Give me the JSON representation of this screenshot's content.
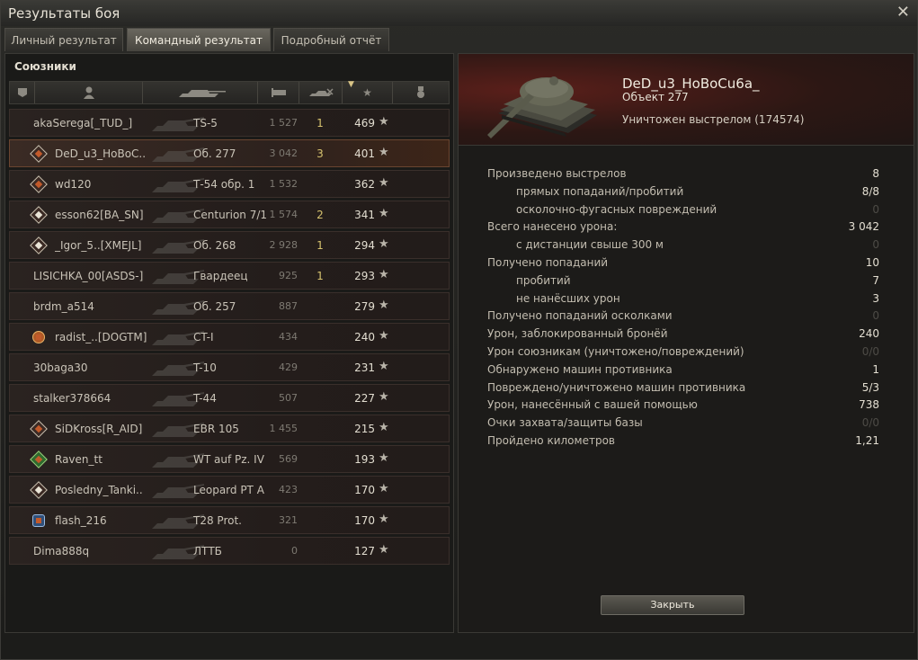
{
  "window": {
    "title": "Результаты боя"
  },
  "tabs": [
    {
      "label": "Личный результат"
    },
    {
      "label": "Командный результат"
    },
    {
      "label": "Подробный отчёт"
    }
  ],
  "allies_label": "Союзники",
  "players": [
    {
      "name": "akaSerega[_TUD_]",
      "tank": "TS-5",
      "damage": "1 527",
      "kills": "1",
      "xp": "469",
      "rank": ""
    },
    {
      "name": "DeD_u3_HoBoC..",
      "tank": "Об. 277",
      "damage": "3 042",
      "kills": "3",
      "xp": "401",
      "rank": "orange-diamond"
    },
    {
      "name": "wd120",
      "tank": "Т-54 обр. 1",
      "damage": "1 532",
      "kills": "",
      "xp": "362",
      "rank": "orange-diamond"
    },
    {
      "name": "esson62[BA_SN]",
      "tank": "Centurion 7/1",
      "damage": "1 574",
      "kills": "2",
      "xp": "341",
      "rank": "white-diamond"
    },
    {
      "name": "_Igor_5..[XMEJL]",
      "tank": "Об. 268",
      "damage": "2 928",
      "kills": "1",
      "xp": "294",
      "rank": "white-diamond"
    },
    {
      "name": "LISICHKA_00[ASDS-]",
      "tank": "Гвардеец",
      "damage": "925",
      "kills": "1",
      "xp": "293",
      "rank": ""
    },
    {
      "name": "brdm_a514",
      "tank": "Об. 257",
      "damage": "887",
      "kills": "",
      "xp": "279",
      "rank": ""
    },
    {
      "name": "radist_..[DOGTM]",
      "tank": "CT-I",
      "damage": "434",
      "kills": "",
      "xp": "240",
      "rank": "orange-badge"
    },
    {
      "name": "30baga30",
      "tank": "T-10",
      "damage": "429",
      "kills": "",
      "xp": "231",
      "rank": ""
    },
    {
      "name": "stalker378664",
      "tank": "T-44",
      "damage": "507",
      "kills": "",
      "xp": "227",
      "rank": ""
    },
    {
      "name": "SiDKross[R_AID]",
      "tank": "EBR 105",
      "damage": "1 455",
      "kills": "",
      "xp": "215",
      "rank": "orange-diamond"
    },
    {
      "name": "Raven_tt",
      "tank": "WT auf Pz. IV",
      "damage": "569",
      "kills": "",
      "xp": "193",
      "rank": "green-diamond"
    },
    {
      "name": "Posledny_Tanki..",
      "tank": "Leopard PT A",
      "damage": "423",
      "kills": "",
      "xp": "170",
      "rank": "white-diamond"
    },
    {
      "name": "flash_216",
      "tank": "T28 Prot.",
      "damage": "321",
      "kills": "",
      "xp": "170",
      "rank": "blue-badge"
    },
    {
      "name": "Dima888q",
      "tank": "ЛТТБ",
      "damage": "0",
      "kills": "",
      "xp": "127",
      "rank": ""
    }
  ],
  "detail": {
    "player_name": "DeD_u3_HoBoCu6a_",
    "tank": "Объект 277",
    "status": "Уничтожен выстрелом (174574)"
  },
  "stats": [
    {
      "label": "Произведено выстрелов",
      "value": "8",
      "sub": false
    },
    {
      "label": "прямых попаданий/пробитий",
      "value": "8/8",
      "sub": true
    },
    {
      "label": "осколочно-фугасных повреждений",
      "value": "0",
      "sub": true,
      "zero": true
    },
    {
      "label": "Всего нанесено урона:",
      "value": "3 042",
      "sub": false
    },
    {
      "label": "с дистанции свыше 300 м",
      "value": "0",
      "sub": true,
      "zero": true
    },
    {
      "label": "Получено попаданий",
      "value": "10",
      "sub": false
    },
    {
      "label": "пробитий",
      "value": "7",
      "sub": true
    },
    {
      "label": "не нанёсших урон",
      "value": "3",
      "sub": true
    },
    {
      "label": "Получено попаданий осколками",
      "value": "0",
      "sub": false,
      "zero": true
    },
    {
      "label": "Урон, заблокированный бронёй",
      "value": "240",
      "sub": false
    },
    {
      "label": "Урон союзникам (уничтожено/повреждений)",
      "value": "0/0",
      "sub": false,
      "zero": true
    },
    {
      "label": "Обнаружено машин противника",
      "value": "1",
      "sub": false
    },
    {
      "label": "Повреждено/уничтожено машин противника",
      "value": "5/3",
      "sub": false
    },
    {
      "label": "Урон, нанесённый с вашей помощью",
      "value": "738",
      "sub": false
    },
    {
      "label": "Очки захвата/защиты базы",
      "value": "0/0",
      "sub": false,
      "zero": true
    },
    {
      "label": "Пройдено километров",
      "value": "1,21",
      "sub": false
    }
  ],
  "close_button": "Закрыть",
  "icons": {
    "close": "close-icon",
    "star": "star-icon",
    "platoon": "platoon-icon",
    "player": "player-icon",
    "tank": "tank-icon",
    "damage": "damage-icon",
    "kills": "kills-icon",
    "xp": "xp-icon",
    "medal": "medal-icon"
  },
  "colors": {
    "selected_row": "#6a4530",
    "kills": "#d7c36f"
  }
}
